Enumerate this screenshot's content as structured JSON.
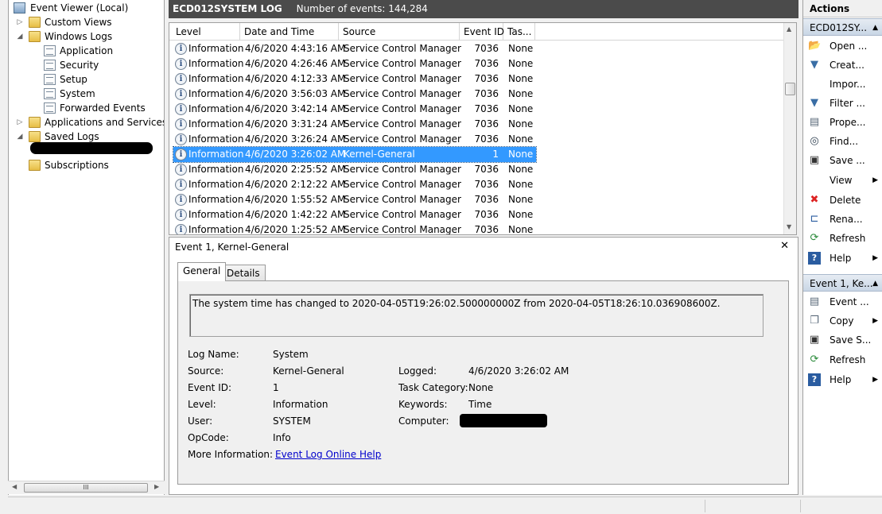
{
  "tree": {
    "items": [
      {
        "label": "Event Viewer (Local)"
      },
      {
        "label": "Custom Views"
      },
      {
        "label": "Windows Logs"
      },
      {
        "label": "Application"
      },
      {
        "label": "Security"
      },
      {
        "label": "Setup"
      },
      {
        "label": "System"
      },
      {
        "label": "Forwarded Events"
      },
      {
        "label": "Applications and Services Lo"
      },
      {
        "label": "Saved Logs"
      },
      {
        "label": "Subscriptions"
      }
    ],
    "scroll_thumb": "III"
  },
  "log_header": {
    "title": "ECD012SYSTEM LOG",
    "count": "Number of events: 144,284"
  },
  "grid": {
    "columns": [
      "Level",
      "Date and Time",
      "Source",
      "Event ID",
      "Tas..."
    ],
    "rows": [
      {
        "level": "Information",
        "datetime": "4/6/2020 4:43:16 AM",
        "source": "Service Control Manager",
        "event_id": "7036",
        "task": "None"
      },
      {
        "level": "Information",
        "datetime": "4/6/2020 4:26:46 AM",
        "source": "Service Control Manager",
        "event_id": "7036",
        "task": "None"
      },
      {
        "level": "Information",
        "datetime": "4/6/2020 4:12:33 AM",
        "source": "Service Control Manager",
        "event_id": "7036",
        "task": "None"
      },
      {
        "level": "Information",
        "datetime": "4/6/2020 3:56:03 AM",
        "source": "Service Control Manager",
        "event_id": "7036",
        "task": "None"
      },
      {
        "level": "Information",
        "datetime": "4/6/2020 3:42:14 AM",
        "source": "Service Control Manager",
        "event_id": "7036",
        "task": "None"
      },
      {
        "level": "Information",
        "datetime": "4/6/2020 3:31:24 AM",
        "source": "Service Control Manager",
        "event_id": "7036",
        "task": "None"
      },
      {
        "level": "Information",
        "datetime": "4/6/2020 3:26:24 AM",
        "source": "Service Control Manager",
        "event_id": "7036",
        "task": "None"
      },
      {
        "level": "Information",
        "datetime": "4/6/2020 3:26:02 AM",
        "source": "Kernel-General",
        "event_id": "1",
        "task": "None",
        "selected": true
      },
      {
        "level": "Information",
        "datetime": "4/6/2020 2:25:52 AM",
        "source": "Service Control Manager",
        "event_id": "7036",
        "task": "None"
      },
      {
        "level": "Information",
        "datetime": "4/6/2020 2:12:22 AM",
        "source": "Service Control Manager",
        "event_id": "7036",
        "task": "None"
      },
      {
        "level": "Information",
        "datetime": "4/6/2020 1:55:52 AM",
        "source": "Service Control Manager",
        "event_id": "7036",
        "task": "None"
      },
      {
        "level": "Information",
        "datetime": "4/6/2020 1:42:22 AM",
        "source": "Service Control Manager",
        "event_id": "7036",
        "task": "None"
      },
      {
        "level": "Information",
        "datetime": "4/6/2020 1:25:52 AM",
        "source": "Service Control Manager",
        "event_id": "7036",
        "task": "None"
      }
    ]
  },
  "detail": {
    "title": "Event 1, Kernel-General",
    "close": "✕",
    "tabs": [
      "General",
      "Details"
    ],
    "message": "The system time has changed to 2020-04-05T19:26:02.500000000Z from 2020-04-05T18:26:10.036908600Z.",
    "labels": {
      "log_name": "Log Name:",
      "source": "Source:",
      "event_id": "Event ID:",
      "level": "Level:",
      "user": "User:",
      "opcode": "OpCode:",
      "more_info": "More Information:",
      "logged": "Logged:",
      "task_category": "Task Category:",
      "keywords": "Keywords:",
      "computer": "Computer:"
    },
    "values": {
      "log_name": "System",
      "source": "Kernel-General",
      "event_id": "1",
      "level": "Information",
      "user": "SYSTEM",
      "opcode": "Info",
      "more_info_link": "Event Log Online Help",
      "logged": "4/6/2020 3:26:02 AM",
      "task_category": "None",
      "keywords": "Time"
    }
  },
  "actions": {
    "title": "Actions",
    "section1": "ECD012SY...",
    "items1": [
      {
        "label": "Open ...",
        "icon": "folder-open-icon"
      },
      {
        "label": "Creat...",
        "icon": "filter-icon"
      },
      {
        "label": "Impor...",
        "icon": ""
      },
      {
        "label": "Filter ...",
        "icon": "filter-icon"
      },
      {
        "label": "Prope...",
        "icon": "properties-icon"
      },
      {
        "label": "Find...",
        "icon": "binoculars-icon"
      },
      {
        "label": "Save ...",
        "icon": "save-icon"
      },
      {
        "label": "View",
        "icon": ""
      },
      {
        "label": "Delete",
        "icon": "delete-icon"
      },
      {
        "label": "Rena...",
        "icon": "rename-icon"
      },
      {
        "label": "Refresh",
        "icon": "refresh-icon"
      },
      {
        "label": "Help",
        "icon": "help-icon"
      }
    ],
    "section2": "Event 1, Ke...",
    "items2": [
      {
        "label": "Event ...",
        "icon": "event-properties-icon"
      },
      {
        "label": "Copy",
        "icon": "copy-icon"
      },
      {
        "label": "Save S...",
        "icon": "save-icon"
      },
      {
        "label": "Refresh",
        "icon": "refresh-icon"
      },
      {
        "label": "Help",
        "icon": "help-icon"
      }
    ]
  },
  "colors": {
    "selection": "#3399ff",
    "header": "#4b4b4b",
    "link": "#0000cc"
  }
}
